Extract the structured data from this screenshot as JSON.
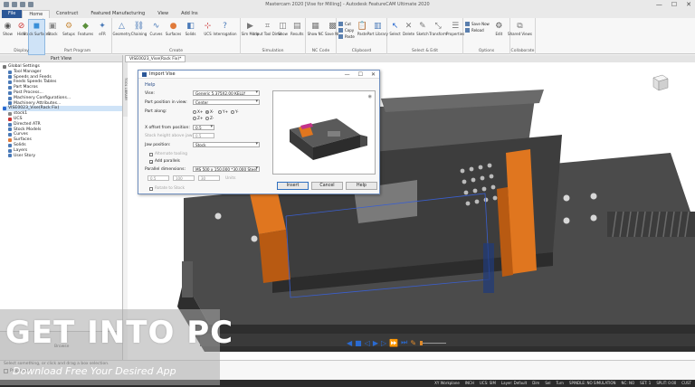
{
  "window": {
    "title": "Mastercam 2020 [Vise for Milling] - Autodesk FeatureCAM Ultimate 2020",
    "controls": [
      "—",
      "☐",
      "✕"
    ]
  },
  "tabs": [
    "File",
    "Home",
    "Construct",
    "Featured Manufacturing",
    "View",
    "Add Ins"
  ],
  "active_tab": "Home",
  "ribbon": {
    "groups": [
      {
        "label": "Display",
        "buttons": [
          {
            "label": "Show",
            "icon": "eye-icon",
            "color": "#555555"
          },
          {
            "label": "Hide",
            "icon": "hide-icon",
            "color": "#cc3333"
          },
          {
            "label": "Stock Surfaces",
            "icon": "stock-icon",
            "color": "#3a8fd8",
            "selected": true
          }
        ]
      },
      {
        "label": "Part Program",
        "buttons": [
          {
            "label": "Stock",
            "icon": "stock-box-icon",
            "color": "#8a8a8a"
          },
          {
            "label": "Setups",
            "icon": "setups-icon",
            "color": "#c88a3a"
          },
          {
            "label": "Features",
            "icon": "features-icon",
            "color": "#5a8f3a"
          },
          {
            "label": "eFR",
            "icon": "efr-icon",
            "color": "#4a7ab8"
          }
        ]
      },
      {
        "label": "Create",
        "buttons": [
          {
            "label": "Geometry",
            "icon": "geometry-icon",
            "color": "#4a7ab8"
          },
          {
            "label": "Chaining",
            "icon": "chaining-icon",
            "color": "#4a7ab8"
          },
          {
            "label": "Curves",
            "icon": "curves-icon",
            "color": "#4a7ab8"
          },
          {
            "label": "Surfaces",
            "icon": "surfaces-icon",
            "color": "#e07a3a"
          },
          {
            "label": "Solids",
            "icon": "solids-icon",
            "color": "#4a7ab8"
          },
          {
            "label": "UCS",
            "icon": "ucs-icon",
            "color": "#cc3333"
          },
          {
            "label": "Interrogation",
            "icon": "interrogation-icon",
            "color": "#4a7ab8"
          }
        ]
      },
      {
        "label": "Simulation",
        "buttons": [
          {
            "label": "Sim Mode",
            "icon": "sim-mode-icon",
            "color": "#777777"
          },
          {
            "label": "Input Tool Dims",
            "icon": "tool-dims-icon",
            "color": "#777777"
          },
          {
            "label": "Show",
            "icon": "show-sim-icon",
            "color": "#777777"
          },
          {
            "label": "Results",
            "icon": "results-icon",
            "color": "#777777"
          }
        ]
      },
      {
        "label": "NC Code",
        "buttons": [
          {
            "label": "Show NC",
            "icon": "show-nc-icon",
            "color": "#777777"
          },
          {
            "label": "Save NC",
            "icon": "save-nc-icon",
            "color": "#777777"
          }
        ]
      },
      {
        "label": "Clipboard",
        "small": [
          "Cut",
          "Copy",
          "Paste"
        ],
        "buttons": [
          {
            "label": "Paste",
            "icon": "paste-icon",
            "color": "#b08a3a"
          },
          {
            "label": "Part Library",
            "icon": "part-library-icon",
            "color": "#4a7ab8"
          }
        ]
      },
      {
        "label": "Select & Edit",
        "buttons": [
          {
            "label": "Select",
            "icon": "select-icon",
            "color": "#2a6ad0"
          },
          {
            "label": "Delete",
            "icon": "delete-icon",
            "color": "#777777"
          },
          {
            "label": "Sketch",
            "icon": "sketch-icon",
            "color": "#777777"
          },
          {
            "label": "Transform",
            "icon": "transform-icon",
            "color": "#777777"
          },
          {
            "label": "Properties",
            "icon": "properties-icon",
            "color": "#777777"
          }
        ]
      },
      {
        "label": "Options",
        "small": [
          "Save Now",
          "Reload"
        ],
        "buttons": [
          {
            "label": "Edit",
            "icon": "edit-icon",
            "color": "#555555"
          }
        ]
      },
      {
        "label": "Collaborate",
        "buttons": [
          {
            "label": "Shared Views",
            "icon": "shared-views-icon",
            "color": "#777777"
          }
        ]
      }
    ]
  },
  "part_view": {
    "title": "Part View",
    "document_tab": "VISE0023_Vise(Rack Fix)*",
    "nodes": [
      {
        "label": "Global Settings",
        "indent": 0,
        "color": "#777777"
      },
      {
        "label": "Tool Manager",
        "indent": 1,
        "color": "#4a7ab8"
      },
      {
        "label": "Speeds and Feeds",
        "indent": 1,
        "color": "#4a7ab8"
      },
      {
        "label": "Feeds Speeds Tables",
        "indent": 1,
        "color": "#4a7ab8"
      },
      {
        "label": "Part Macros",
        "indent": 1,
        "color": "#4a7ab8"
      },
      {
        "label": "Post Process...",
        "indent": 1,
        "color": "#4a7ab8"
      },
      {
        "label": "Machinery Configurations...",
        "indent": 1,
        "color": "#4a7ab8"
      },
      {
        "label": "Machinery Attributes...",
        "indent": 1,
        "color": "#4a7ab8"
      },
      {
        "label": "VISE0023_Vise(Rack Fix)",
        "indent": 0,
        "color": "#2a6ad0",
        "highlight": true
      },
      {
        "label": "stock1",
        "indent": 1,
        "color": "#888888"
      },
      {
        "label": "UCS",
        "indent": 1,
        "color": "#cc3333"
      },
      {
        "label": "Directed ATR",
        "indent": 1,
        "color": "#4a7ab8"
      },
      {
        "label": "Stock Models",
        "indent": 1,
        "color": "#4a7ab8"
      },
      {
        "label": "Curves",
        "indent": 1,
        "color": "#4a7ab8"
      },
      {
        "label": "Surfaces",
        "indent": 1,
        "color": "#e07a3a"
      },
      {
        "label": "Solids",
        "indent": 1,
        "color": "#4a7ab8"
      },
      {
        "label": "Layers",
        "indent": 1,
        "color": "#4a7ab8"
      },
      {
        "label": "User Story",
        "indent": 1,
        "color": "#4a7ab8"
      }
    ]
  },
  "vertical_strip": "TOOL LIBRARY",
  "dialog": {
    "title": "Import Vise",
    "controls": [
      "—",
      "☐",
      "✕"
    ],
    "help": "Help",
    "fields": {
      "vise_label": "Vise:",
      "vise_value": "Generic 5.375X2.00 KELLY",
      "position_view_label": "Part position in view:",
      "position_view_value": "Center",
      "part_along_label": "Part along:",
      "radios_row1": [
        {
          "label": "X+",
          "on": false
        },
        {
          "label": "X-",
          "on": true
        },
        {
          "label": "Y+",
          "on": false
        },
        {
          "label": "Y-",
          "on": false
        }
      ],
      "radios_row2": [
        {
          "label": "Z+",
          "on": false
        },
        {
          "label": "Z-",
          "on": false
        }
      ],
      "jaw_position_label": "X offset from position:",
      "jaw_position_value": "0.5",
      "ret_label": "Stock height above jaw:",
      "ret_value": "0.5",
      "jaw_position2_label": "Jaw position:",
      "jaw_position2_value": "Stock",
      "alt_check_label": "Alternate tooling",
      "add_check_label": "Add parallels",
      "parallel_label": "Parallel dimensions:",
      "parallel_value": "MS 500 x 150.000 *30.000 Steel",
      "dims": [
        "0.5",
        "100",
        "30"
      ],
      "dims_units": "Units",
      "rotate_label": "Rotate to Stock"
    },
    "buttons": [
      "Insert",
      "Cancel",
      "Help"
    ]
  },
  "viewport": {
    "playbar_icons": [
      "rewind-icon",
      "stop-icon",
      "step-back-icon",
      "play-icon",
      "step-icon",
      "fast-forward-icon",
      "end-icon",
      "settings-icon"
    ]
  },
  "lower_panel": {
    "label": "Browse"
  },
  "prompt": {
    "text": "Select something, or click and drag a box selection.",
    "properties_label": "Properties"
  },
  "status_items": [
    "XY Workplane",
    "INCH",
    "UCS: SIM",
    "Layer: Default",
    "Dim",
    "Sel",
    "Turn",
    "SPINDLE: NO SIMULATION",
    "NC: NO",
    "SET: 1",
    "SPLIT: 0:00",
    "CUST"
  ],
  "watermark": {
    "title": "GET INTO PC",
    "tagline": "Download Free Your Desired App"
  }
}
